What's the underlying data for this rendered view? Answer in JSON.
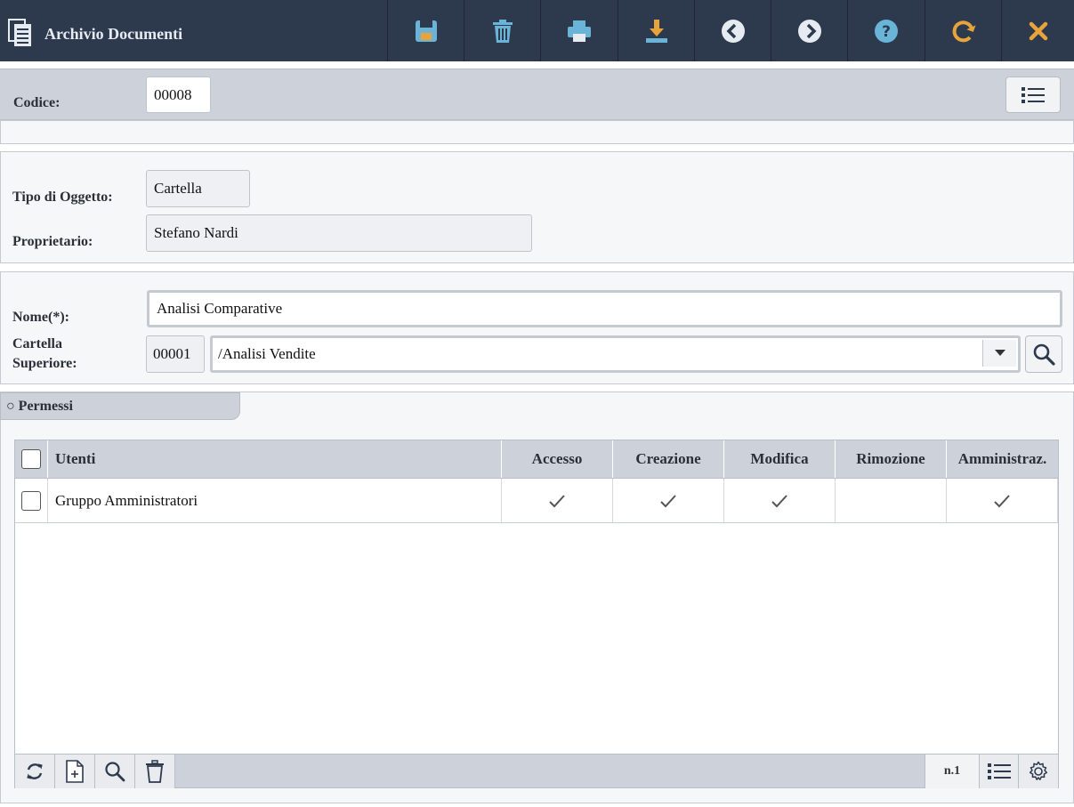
{
  "header": {
    "title": "Archivio Documenti",
    "accent": "#2d3a4e",
    "toolbar": [
      {
        "icon": "save-icon",
        "color": "#6ab4d8"
      },
      {
        "icon": "trash-icon",
        "color": "#6ab4d8"
      },
      {
        "icon": "print-icon",
        "color": "#6ab4d8"
      },
      {
        "icon": "download-icon",
        "color": "#e8a33a"
      },
      {
        "icon": "chevron-left-icon",
        "color": "#e6ebf2"
      },
      {
        "icon": "chevron-right-icon",
        "color": "#e6ebf2"
      },
      {
        "icon": "help-icon",
        "color": "#6ab4d8"
      },
      {
        "icon": "refresh-icon",
        "color": "#e8a33a"
      },
      {
        "icon": "close-icon",
        "color": "#e8a33a"
      }
    ]
  },
  "codice": {
    "label": "Codice:",
    "value": "00008"
  },
  "info": {
    "tipo_label": "Tipo di Oggetto:",
    "tipo_value": "Cartella",
    "proprietario_label": "Proprietario:",
    "proprietario_value": "Stefano Nardi"
  },
  "form": {
    "nome_label": "Nome(*):",
    "nome_value": "Analisi Comparative",
    "cartella_label_1": "Cartella",
    "cartella_label_2": "Superiore:",
    "cartella_code": "00001",
    "cartella_value": "/Analisi Vendite"
  },
  "permessi": {
    "tab_label": "○ Permessi",
    "columns": [
      "Utenti",
      "Accesso",
      "Creazione",
      "Modifica",
      "Rimozione",
      "Amministraz."
    ],
    "rows": [
      {
        "utente": "Gruppo Amministratori",
        "accesso": true,
        "creazione": true,
        "modifica": true,
        "rimozione": false,
        "amministraz": true
      }
    ],
    "count": "n.1"
  }
}
